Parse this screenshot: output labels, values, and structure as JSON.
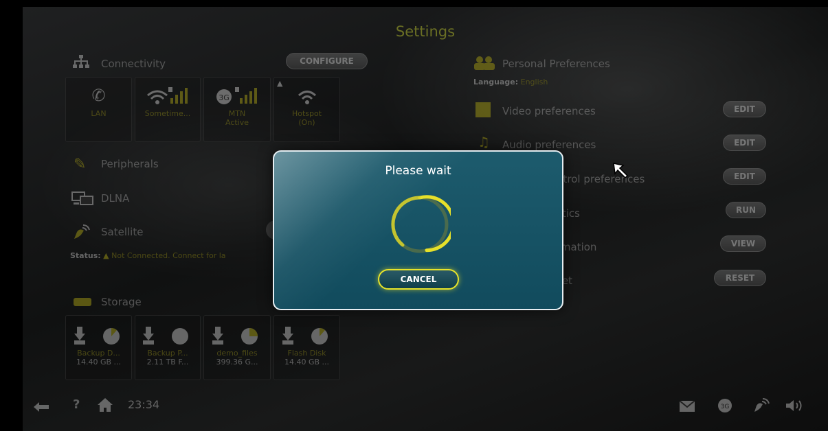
{
  "header": {
    "title": "Settings"
  },
  "connectivity": {
    "label": "Connectivity",
    "configure_label": "CONFIGURE",
    "tiles": [
      {
        "icon": "lan-icon",
        "label": "LAN",
        "sub": ""
      },
      {
        "icon": "wifi-icon",
        "label": "Sometime...",
        "sub": ""
      },
      {
        "icon": "3g-icon",
        "icon_text": "3G",
        "label": "MTN",
        "sub": "Active"
      },
      {
        "icon": "hotspot-icon",
        "label": "Hotspot",
        "sub": "(On)"
      }
    ]
  },
  "peripherals": {
    "label": "Peripherals"
  },
  "dlna": {
    "label": "DLNA"
  },
  "satellite": {
    "label": "Satellite",
    "status_label": "Status:",
    "status_text": "Not Connected. Connect for la"
  },
  "storage": {
    "label": "Storage",
    "items": [
      {
        "name": "Backup D...",
        "size": "14.40 GB ..."
      },
      {
        "name": "Backup P...",
        "size": "2.11 TB F..."
      },
      {
        "name": "demo_files",
        "size": "399.36 G..."
      },
      {
        "name": "Flash Disk",
        "size": "14.40 GB ..."
      }
    ]
  },
  "preferences": {
    "label": "Personal Preferences",
    "language_label": "Language:",
    "language_value": "English",
    "rows": [
      {
        "label": "Video preferences",
        "button": "EDIT"
      },
      {
        "label": "Audio preferences",
        "button": "EDIT"
      },
      {
        "label": "ntrol preferences",
        "button": "EDIT"
      },
      {
        "label": "stics",
        "button": "RUN"
      },
      {
        "label": "rmation",
        "button": "VIEW"
      },
      {
        "label": "set",
        "button": "RESET"
      }
    ]
  },
  "footer": {
    "time": "23:34"
  },
  "dialog": {
    "title": "Please wait",
    "cancel_label": "CANCEL",
    "spinner_color": "#e6e02a"
  },
  "colors": {
    "accent": "#d9d42a",
    "dialog_bg": "#114b5d"
  }
}
